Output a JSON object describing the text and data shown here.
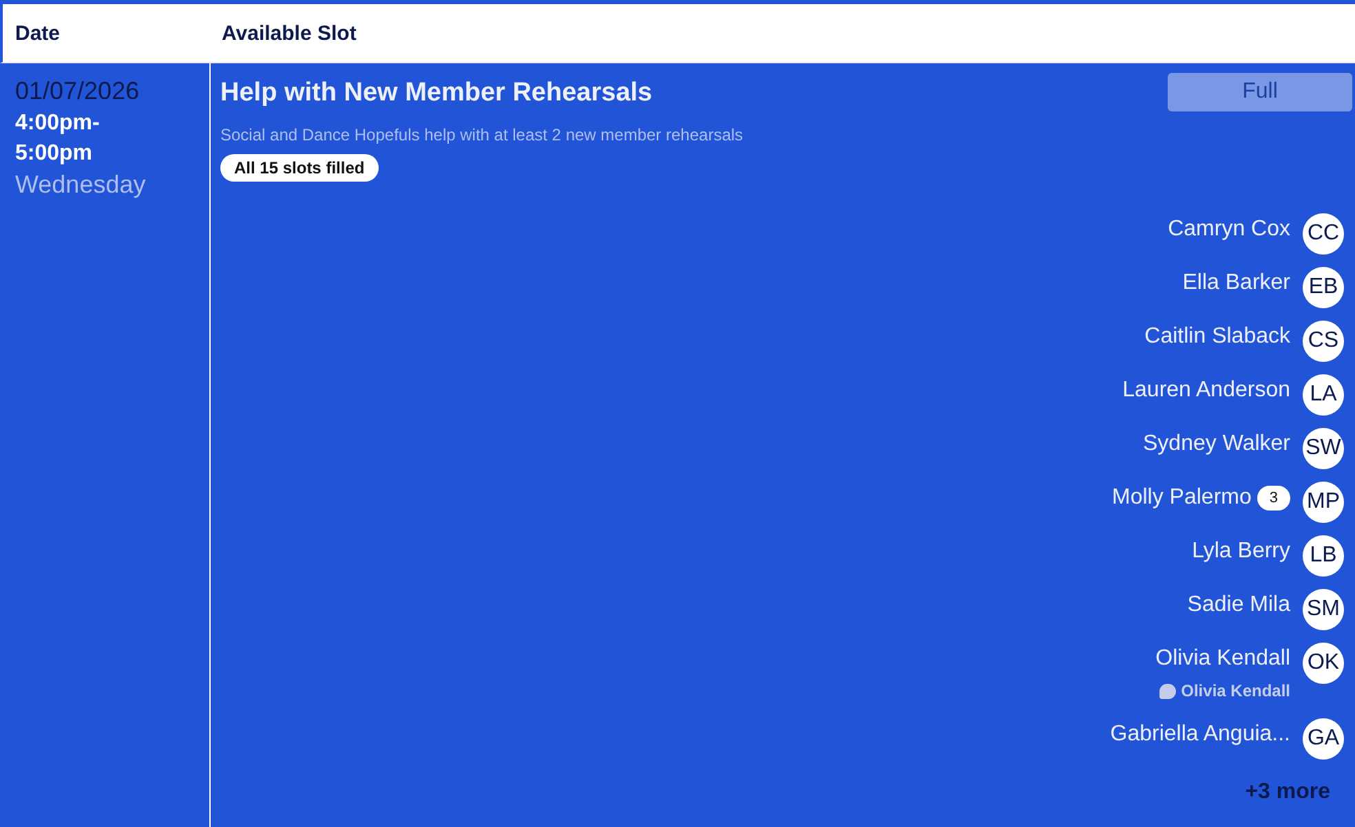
{
  "table": {
    "columns": [
      "Date",
      "Available Slot"
    ],
    "rows": [
      {
        "date": "01/07/2026",
        "time": "4:00pm-\n5:00pm",
        "weekday": "Wednesday",
        "title": "Help with New Member Rehearsals",
        "description": "Social and Dance Hopefuls help with at least 2 new member rehearsals",
        "status": "All 15 slots filled",
        "button": {
          "label": "Full",
          "disabled": true
        },
        "members": [
          {
            "name": "Camryn Cox",
            "initials": "CC"
          },
          {
            "name": "Ella Barker",
            "initials": "EB"
          },
          {
            "name": "Caitlin Slaback",
            "initials": "CS"
          },
          {
            "name": "Lauren Anderson",
            "initials": "LA"
          },
          {
            "name": "Sydney Walker",
            "initials": "SW"
          },
          {
            "name": "Molly Palermo",
            "initials": "MP",
            "count": "3"
          },
          {
            "name": "Lyla Berry",
            "initials": "LB"
          },
          {
            "name": "Sadie Mila",
            "initials": "SM"
          },
          {
            "name": "Olivia Kendall",
            "initials": "OK",
            "comment": "Olivia Kendall"
          },
          {
            "name": "Gabriella Anguia...",
            "initials": "GA"
          }
        ],
        "more": "+3 more"
      }
    ]
  }
}
